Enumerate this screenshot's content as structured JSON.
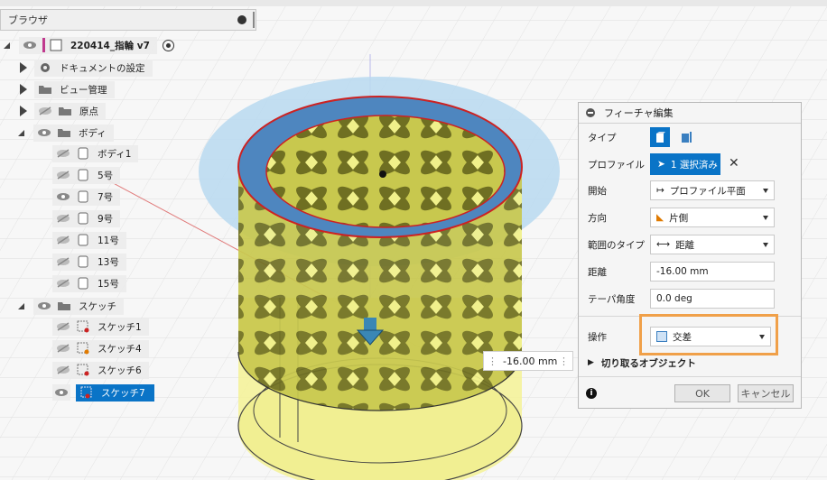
{
  "browser": {
    "title": "ブラウザ",
    "root": "220414_指輪 v7",
    "items": [
      {
        "label": "ドキュメントの設定"
      },
      {
        "label": "ビュー管理"
      },
      {
        "label": "原点"
      },
      {
        "label": "ボディ"
      },
      {
        "label": "ボディ1"
      },
      {
        "label": "5号"
      },
      {
        "label": "7号"
      },
      {
        "label": "9号"
      },
      {
        "label": "11号"
      },
      {
        "label": "13号"
      },
      {
        "label": "15号"
      },
      {
        "label": "スケッチ"
      },
      {
        "label": "スケッチ1"
      },
      {
        "label": "スケッチ4"
      },
      {
        "label": "スケッチ6"
      },
      {
        "label": "スケッチ7"
      }
    ]
  },
  "dialog": {
    "title": "フィーチャ編集",
    "type_label": "タイプ",
    "profile_label": "プロファイル",
    "profile_value": "1 選択済み",
    "start_label": "開始",
    "start_value": "プロファイル平面",
    "direction_label": "方向",
    "direction_value": "片側",
    "extent_label": "範囲のタイプ",
    "extent_value": "距離",
    "distance_label": "距離",
    "distance_value": "-16.00 mm",
    "taper_label": "テーパ角度",
    "taper_value": "0.0 deg",
    "operation_label": "操作",
    "operation_value": "交差",
    "objects_label": "切り取るオブジェクト",
    "ok_label": "OK",
    "cancel_label": "キャンセル"
  },
  "viewport": {
    "dimension_value": "-16.00 mm"
  },
  "colors": {
    "accent": "#0a74c7",
    "highlight": "#f0a049",
    "ring_yellow": "#dede5a",
    "ring_olive": "#8a8a2a",
    "sketch_red": "#cc2222",
    "plane_blue": "#b9d9f0"
  }
}
